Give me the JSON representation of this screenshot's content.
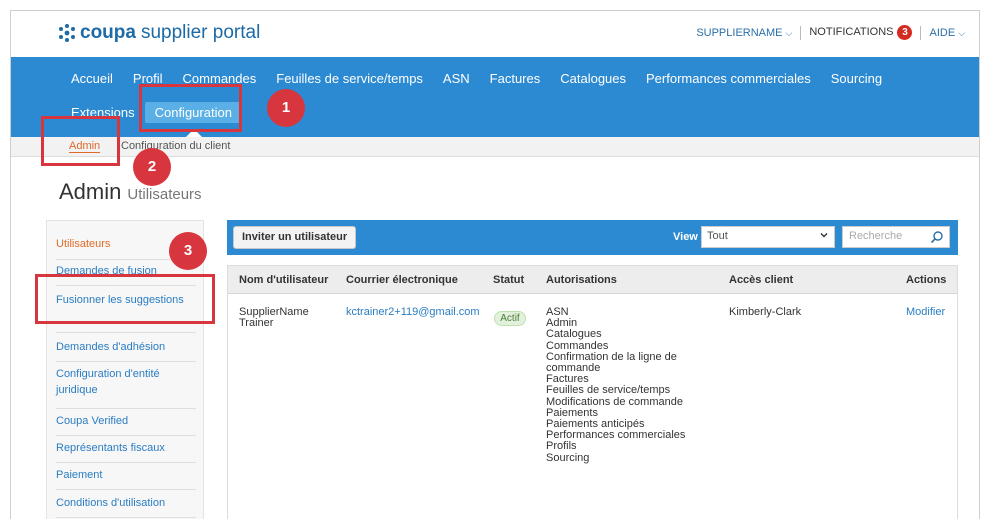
{
  "brand": {
    "coupa": "coupa",
    "rest": "supplier portal",
    "accent": "#2c8ad3"
  },
  "top_links": {
    "supplier": "SUPPLIERNAME",
    "notifications": "NOTIFICATIONS",
    "notifications_count": "3",
    "help": "AIDE"
  },
  "nav": {
    "row1": [
      "Accueil",
      "Profil",
      "Commandes",
      "Feuilles de service/temps",
      "ASN",
      "Factures",
      "Catalogues",
      "Performances commerciales",
      "Sourcing"
    ],
    "row2": [
      "Extensions",
      "Configuration"
    ]
  },
  "subnav": {
    "admin": "Admin",
    "client_config": "Configuration du client"
  },
  "page": {
    "title": "Admin",
    "subtitle": "Utilisateurs"
  },
  "sidebar": {
    "items": [
      "Utilisateurs",
      "Demandes de fusion",
      "Fusionner les suggestions",
      "Demandes d'adhésion",
      "Configuration d'entité juridique",
      "Coupa Verified",
      "Représentants fiscaux",
      "Paiement",
      "Conditions d'utilisation"
    ]
  },
  "toolbar": {
    "invite_label": "Inviter un utilisateur",
    "view_label": "View",
    "view_value": "Tout",
    "search_placeholder": "Recherche"
  },
  "table": {
    "headers": [
      "Nom d'utilisateur",
      "Courrier électronique",
      "Statut",
      "Autorisations",
      "Accès client",
      "Actions"
    ],
    "row": {
      "name": "SupplierName Trainer",
      "email": "kctrainer2+119@gmail.com",
      "status": "Actif",
      "permissions": [
        "ASN",
        "Admin",
        "Catalogues",
        "Commandes",
        "Confirmation de la ligne de commande",
        "Factures",
        "Feuilles de service/temps",
        "Modifications de commande",
        "Paiements",
        "Paiements anticipés",
        "Performances commerciales",
        "Profils",
        "Sourcing"
      ],
      "client_access": "Kimberly-Clark",
      "action": "Modifier"
    }
  },
  "annotations": [
    "1",
    "2",
    "3"
  ]
}
